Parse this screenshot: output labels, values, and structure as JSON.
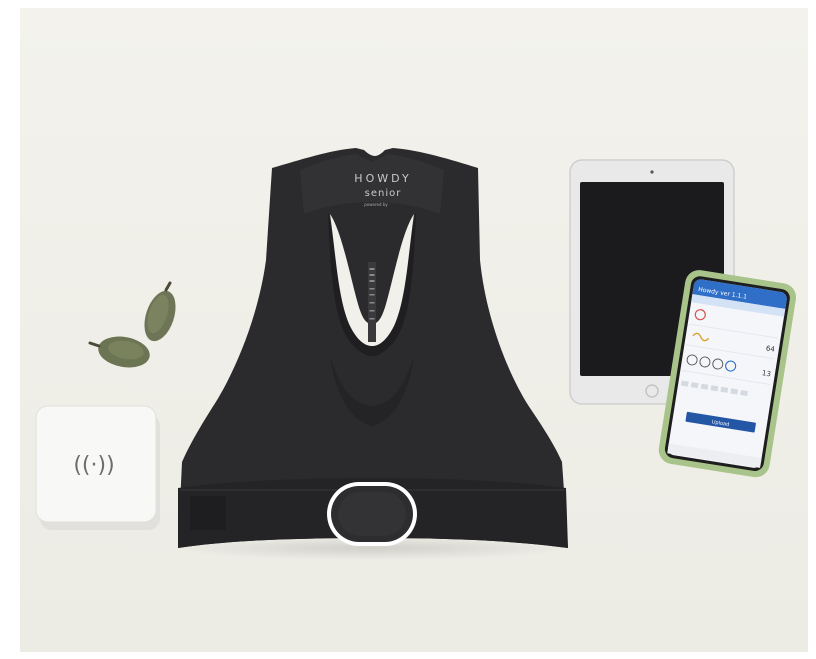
{
  "garment": {
    "brand": "HOWDY",
    "subbrand": "senior",
    "powered_by": "powered by"
  },
  "charger": {
    "icon": "wireless-charging-icon",
    "symbol": "((·))"
  },
  "phone_app": {
    "title": "Howdy ver 1.1.1",
    "value_1": "64",
    "value_2": "13",
    "button_label": "Upload"
  },
  "colors": {
    "background": "#f1f0ea",
    "garment": "#2b2b2d",
    "phone_case": "#a9c48a",
    "app_header": "#2f6fc7"
  }
}
